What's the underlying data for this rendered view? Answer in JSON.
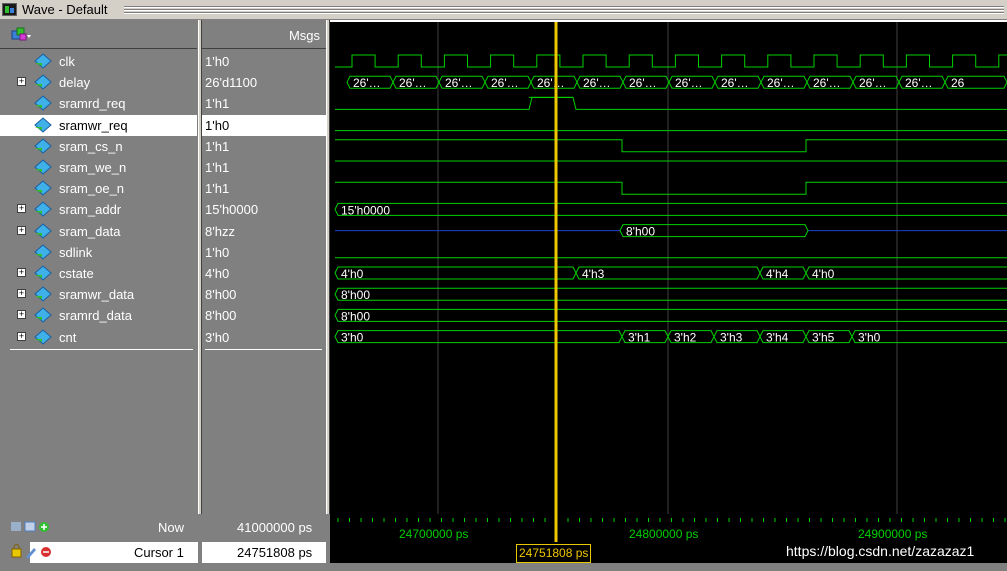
{
  "window": {
    "title": "Wave - Default"
  },
  "header": {
    "msgs_label": "Msgs"
  },
  "signals": [
    {
      "name": "clk",
      "value": "1'h0",
      "expandable": false
    },
    {
      "name": "delay",
      "value": "26'd1100",
      "expandable": true
    },
    {
      "name": "sramrd_req",
      "value": "1'h1",
      "expandable": false
    },
    {
      "name": "sramwr_req",
      "value": "1'h0",
      "expandable": false,
      "selected": true
    },
    {
      "name": "sram_cs_n",
      "value": "1'h1",
      "expandable": false
    },
    {
      "name": "sram_we_n",
      "value": "1'h1",
      "expandable": false
    },
    {
      "name": "sram_oe_n",
      "value": "1'h1",
      "expandable": false
    },
    {
      "name": "sram_addr",
      "value": "15'h0000",
      "expandable": true
    },
    {
      "name": "sram_data",
      "value": "8'hzz",
      "expandable": true
    },
    {
      "name": "sdlink",
      "value": "1'h0",
      "expandable": false
    },
    {
      "name": "cstate",
      "value": "4'h0",
      "expandable": true
    },
    {
      "name": "sramwr_data",
      "value": "8'h00",
      "expandable": true
    },
    {
      "name": "sramrd_data",
      "value": "8'h00",
      "expandable": true
    },
    {
      "name": "cnt",
      "value": "3'h0",
      "expandable": true
    }
  ],
  "wave_labels": {
    "delay": [
      "26'…",
      "26'…",
      "26'…",
      "26'…",
      "26'…",
      "26'…",
      "26'…",
      "26'…",
      "26'…",
      "26'…",
      "26'…",
      "26'…",
      "26'…",
      "26"
    ],
    "sram_addr": "15'h0000",
    "sram_data": "8'h00",
    "cstate": [
      "4'h0",
      "4'h3",
      "4'h4",
      "4'h0"
    ],
    "sramwr_data": "8'h00",
    "sramrd_data": "8'h00",
    "cnt": [
      "3'h0",
      "3'h1",
      "3'h2",
      "3'h3",
      "3'h4",
      "3'h5",
      "3'h0"
    ]
  },
  "status": {
    "now_label": "Now",
    "now_value": "41000000 ps",
    "cursor_label": "Cursor 1",
    "cursor_value": "24751808 ps",
    "cursor_marker": "24751808 ps"
  },
  "timeline": {
    "labels": [
      "24700000 ps",
      "24800000 ps",
      "24900000 ps"
    ]
  },
  "watermark": "https://blog.csdn.net/zazazaz1",
  "colors": {
    "wave": "#00d000",
    "highz": "#1a3fd0",
    "cursor": "#f0c800",
    "grid": "#404040"
  }
}
